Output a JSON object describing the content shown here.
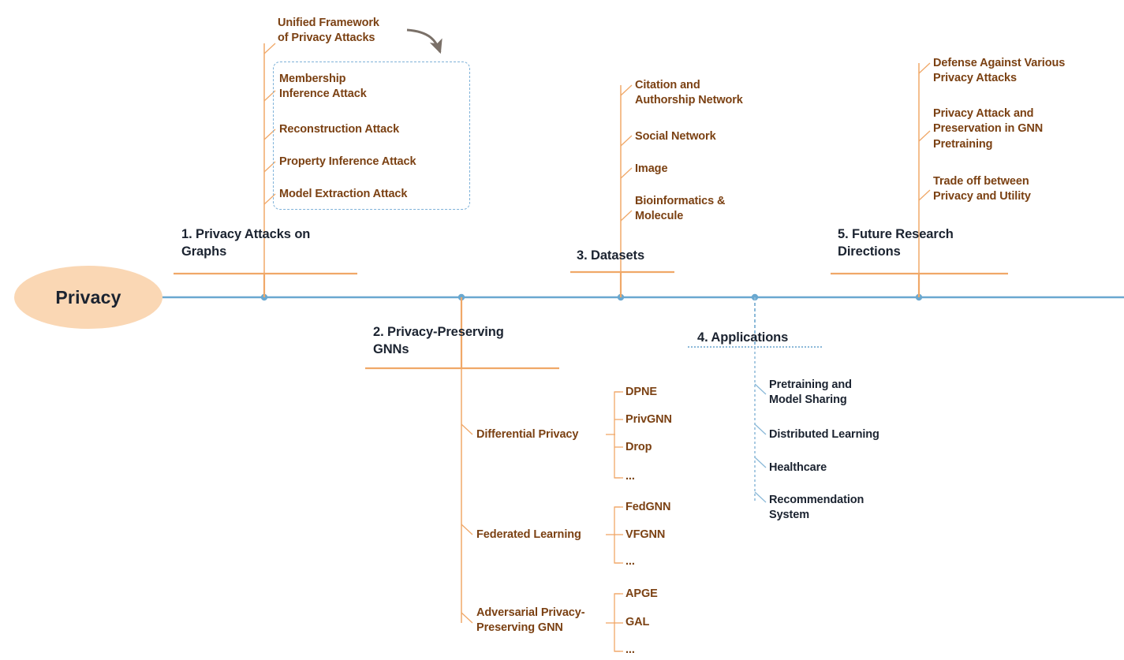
{
  "diagram": {
    "title": "Privacy",
    "root": {
      "label": "Privacy"
    },
    "colors": {
      "root_fill": "#fad7b4",
      "root_text": "#1b2330",
      "spine": "#6aa8d0",
      "orange": "#f0a868",
      "brown_text": "#7b4113",
      "navy_text": "#1b2330",
      "dashed_box": "#7fb2d9",
      "arrow": "#7a7068"
    }
  },
  "annotations": {
    "framework_caption": "Unified Framework\nof Privacy Attacks",
    "arrow_icon": "curved-arrow-icon"
  },
  "branches": [
    {
      "id": "privacy-attacks-on-graphs",
      "title": "1. Privacy Attacks on\nGraphs",
      "side": "top",
      "children": [
        {
          "label": "Membership\nInference Attack"
        },
        {
          "label": "Reconstruction Attack"
        },
        {
          "label": "Property Inference Attack"
        },
        {
          "label": "Model Extraction Attack"
        }
      ]
    },
    {
      "id": "privacy-preserving-gnns",
      "title": "2. Privacy-Preserving\nGNNs",
      "side": "bottom",
      "children": [
        {
          "label": "Differential Privacy",
          "leaves": [
            "DPNE",
            "PrivGNN",
            "Drop",
            "..."
          ]
        },
        {
          "label": "Federated Learning",
          "leaves": [
            "FedGNN",
            "VFGNN",
            "..."
          ]
        },
        {
          "label": "Adversarial Privacy-\nPreserving GNN",
          "leaves": [
            "APGE",
            "GAL",
            "..."
          ]
        }
      ]
    },
    {
      "id": "datasets",
      "title": "3. Datasets",
      "side": "top",
      "children": [
        {
          "label": "Citation and\nAuthorship Network"
        },
        {
          "label": "Social Network"
        },
        {
          "label": "Image"
        },
        {
          "label": "Bioinformatics &\nMolecule"
        }
      ]
    },
    {
      "id": "applications",
      "title": "4. Applications",
      "side": "bottom",
      "children": [
        {
          "label": "Pretraining and\nModel Sharing"
        },
        {
          "label": "Distributed Learning"
        },
        {
          "label": "Healthcare"
        },
        {
          "label": "Recommendation\nSystem"
        }
      ]
    },
    {
      "id": "future-research-directions",
      "title": "5. Future Research\nDirections",
      "side": "top",
      "children": [
        {
          "label": "Defense Against Various\nPrivacy Attacks"
        },
        {
          "label": "Privacy Attack and\nPreservation in GNN\nPretraining"
        },
        {
          "label": "Trade off between\nPrivacy and Utility"
        }
      ]
    }
  ]
}
